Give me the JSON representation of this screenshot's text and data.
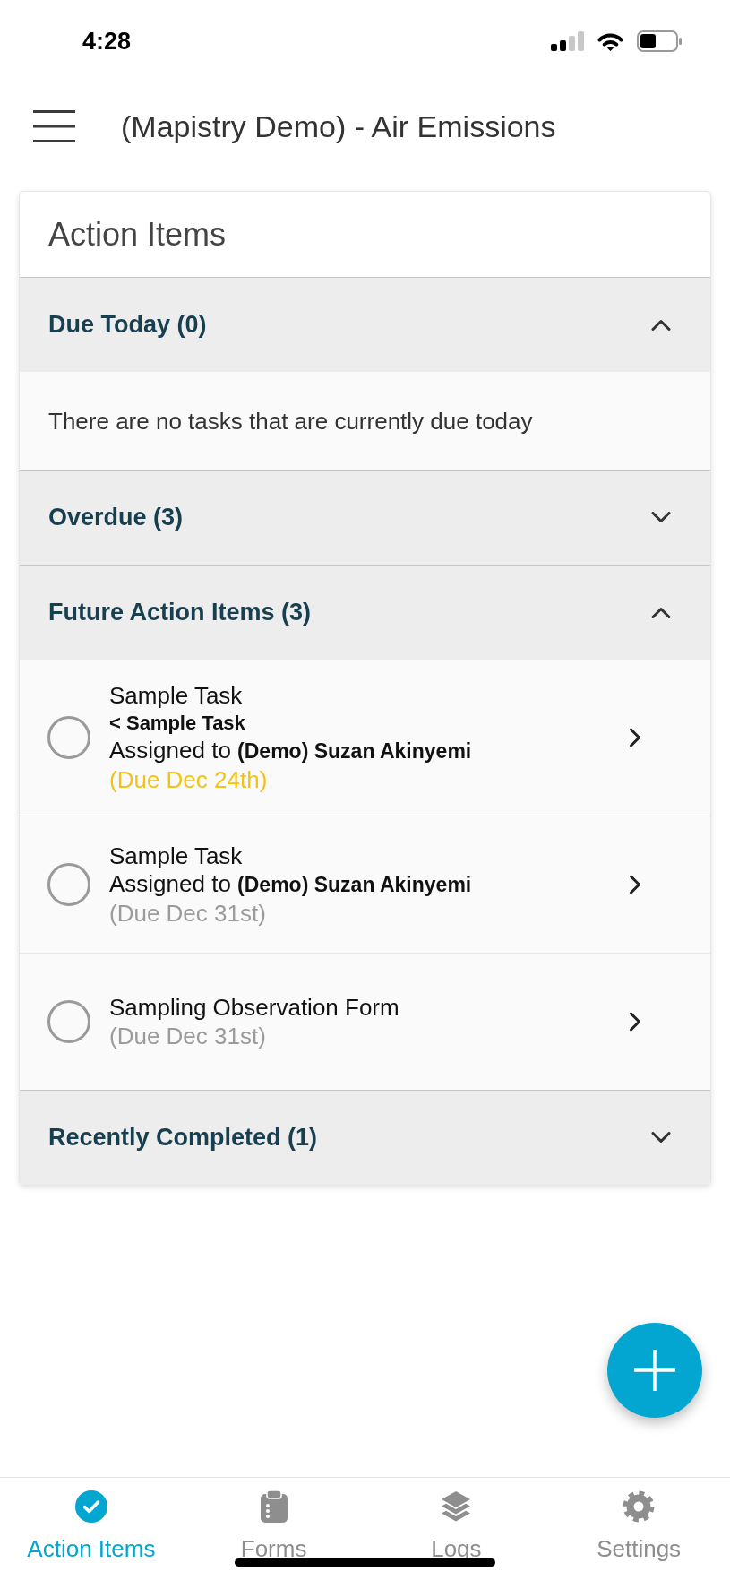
{
  "status_bar": {
    "time": "4:28"
  },
  "header": {
    "title": "(Mapistry Demo) - Air Emissions"
  },
  "card": {
    "title": "Action Items",
    "sections": [
      {
        "label": "Due Today (0)",
        "expanded": true,
        "message": "There are no tasks that are currently due today"
      },
      {
        "label": "Overdue (3)",
        "expanded": false
      },
      {
        "label": "Future Action Items (3)",
        "expanded": true,
        "items": [
          {
            "title": "Sample Task",
            "parent": "< Sample Task",
            "assignment": "Assigned to **(Demo) Suzan Akinyemi**",
            "due": "(Due Dec 24th)",
            "color": "#f2c218",
            "checked": false
          },
          {
            "title": "Sample Task",
            "assignment": "Assigned to **(Demo) Suzan Akinyemi**",
            "due": "(Due Dec 31st)",
            "color": "#9b9b9b",
            "checked": false
          },
          {
            "title": "Sampling Observation Form",
            "due": "(Due Dec 31st)",
            "color": "#9b9b9b",
            "checked": false
          }
        ]
      },
      {
        "label": "Recently Completed (1)",
        "expanded": false
      }
    ]
  },
  "tab_bar": {
    "tabs": [
      {
        "label": "Action Items",
        "selected": true
      },
      {
        "label": "Forms",
        "selected": false
      },
      {
        "label": "Logs",
        "selected": false
      },
      {
        "label": "Settings",
        "selected": false
      }
    ]
  }
}
